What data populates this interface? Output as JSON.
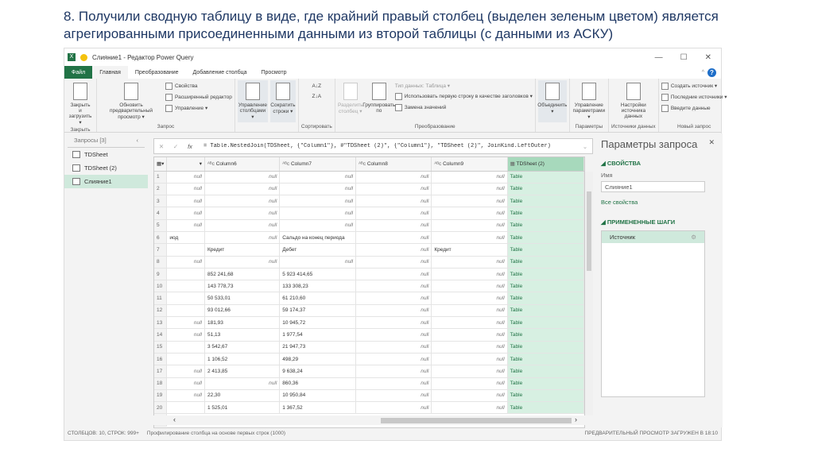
{
  "slide": {
    "title": "8. Получили сводную таблицу в виде, где крайний правый столбец (выделен зеленым цветом) является агрегированными присоединенными данными из второй таблицы (с данными из АСКУ)"
  },
  "window": {
    "title": "Слияние1 - Редактор Power Query",
    "minimize": "—",
    "maximize": "☐",
    "close": "✕",
    "help": "?"
  },
  "tabs": [
    "Файл",
    "Главная",
    "Преобразование",
    "Добавление столбца",
    "Просмотр"
  ],
  "ribbon": {
    "close_group": {
      "label": "Закрыть",
      "close_load": "Закрыть и загрузить ▾"
    },
    "query_group": {
      "label": "Запрос",
      "refresh": "Обновить предварительный просмотр ▾",
      "properties": "Свойства",
      "advanced": "Расширенный редактор",
      "manage": "Управление ▾"
    },
    "cols_group": {
      "manage_cols": "Управление столбцами ▾",
      "reduce_rows": "Сократить строки ▾"
    },
    "sort_group": {
      "label": "Сортировать",
      "asc": "A↓Z",
      "desc": "Z↓A"
    },
    "transform_group": {
      "label": "Преобразование",
      "split": "Разделить столбец ▾",
      "group": "Группировать по",
      "datatype": "Тип данных: Таблица ▾",
      "first_row": "Использовать первую строку в качестве заголовков ▾",
      "replace": "Замена значений"
    },
    "combine": {
      "label": "Объединить ▾"
    },
    "params_group": {
      "label": "Параметры",
      "manage": "Управление параметрами ▾"
    },
    "datasource_group": {
      "label": "Источники данных",
      "settings": "Настройки источника данных"
    },
    "newquery_group": {
      "label": "Новый запрос",
      "new_source": "Создать источник ▾",
      "recent": "Последние источники ▾",
      "enter": "Введите данные"
    }
  },
  "queries": {
    "header": "Запросы [3]",
    "collapse": "‹",
    "items": [
      "TDSheet",
      "TDSheet (2)",
      "Слияние1"
    ],
    "selected": 2
  },
  "formula": {
    "cancel": "✕",
    "commit": "✓",
    "fx": "fx",
    "text": "= Table.NestedJoin(TDSheet, {\"Column1\"}, #\"TDSheet (2)\", {\"Column1\"}, \"TDSheet (2)\", JoinKind.LeftOuter)",
    "expand": "⌄"
  },
  "grid": {
    "columns": [
      "",
      "Column6",
      "Column7",
      "Column8",
      "Column9",
      "TDSheet (2)"
    ],
    "highlight_color": "#d7f0e2",
    "rows": [
      [
        "null",
        "null",
        "null",
        "null",
        "null",
        "Table"
      ],
      [
        "null",
        "null",
        "null",
        "null",
        "null",
        "Table"
      ],
      [
        "null",
        "null",
        "null",
        "null",
        "null",
        "Table"
      ],
      [
        "null",
        "null",
        "null",
        "null",
        "null",
        "Table"
      ],
      [
        "null",
        "null",
        "null",
        "null",
        "null",
        "Table"
      ],
      [
        "иод",
        "null",
        "Сальдо на конец периода",
        "null",
        "null",
        "Table"
      ],
      [
        "",
        "Кредит",
        "Дебет",
        "null",
        "Кредит",
        "Table"
      ],
      [
        "null",
        "null",
        "null",
        "null",
        "null",
        "Table"
      ],
      [
        "",
        "852 241,68",
        "5 923 414,65",
        "null",
        "null",
        "Table"
      ],
      [
        "",
        "143 778,73",
        "133 308,23",
        "null",
        "null",
        "Table"
      ],
      [
        "",
        "50 533,01",
        "61 210,60",
        "null",
        "null",
        "Table"
      ],
      [
        "",
        "93 012,66",
        "59 174,37",
        "null",
        "null",
        "Table"
      ],
      [
        "null",
        "181,93",
        "10 945,72",
        "null",
        "null",
        "Table"
      ],
      [
        "null",
        "51,13",
        "1 977,54",
        "null",
        "null",
        "Table"
      ],
      [
        "",
        "3 542,67",
        "21 947,73",
        "null",
        "null",
        "Table"
      ],
      [
        "",
        "1 106,52",
        "498,29",
        "null",
        "null",
        "Table"
      ],
      [
        "null",
        "2 413,85",
        "9 638,24",
        "null",
        "null",
        "Table"
      ],
      [
        "null",
        "null",
        "860,36",
        "null",
        "null",
        "Table"
      ],
      [
        "null",
        "22,30",
        "10 950,84",
        "null",
        "null",
        "Table"
      ],
      [
        "",
        "1 525,01",
        "1 367,52",
        "null",
        "null",
        "Table"
      ]
    ],
    "last_row_number": "21"
  },
  "settings": {
    "title": "Параметры запроса",
    "close": "✕",
    "properties": "◢ СВОЙСТВА",
    "name_label": "Имя",
    "name_value": "Слияние1",
    "all_props": "Все свойства",
    "steps_title": "◢ ПРИМЕНЕННЫЕ ШАГИ",
    "steps": [
      "Источник"
    ],
    "gear": "⚙"
  },
  "status": {
    "left": "СТОЛБЦОВ: 10, СТРОК: 999+",
    "profiling": "Профилирование столбца на основе первых строк (1000)",
    "right": "ПРЕДВАРИТЕЛЬНЫЙ ПРОСМОТР ЗАГРУЖЕН В 18:10"
  }
}
